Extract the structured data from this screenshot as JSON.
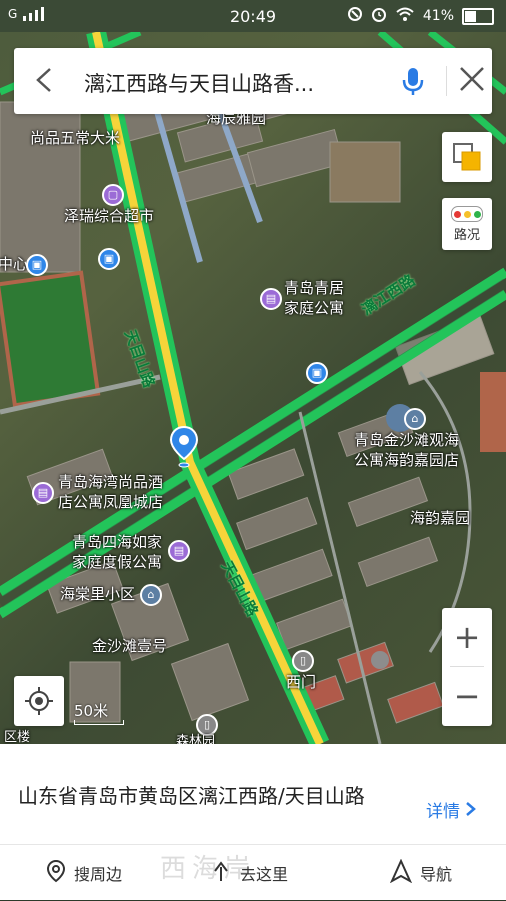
{
  "status_bar": {
    "carrier": "G",
    "time": "20:49",
    "battery": "41%"
  },
  "search": {
    "query": "漓江西路与天目山路香...",
    "back_icon": "chevron-left-icon",
    "mic_icon": "microphone-icon",
    "close_icon": "close-icon"
  },
  "map": {
    "pois": [
      {
        "name": "尚品五常大米"
      },
      {
        "name": "泽瑞综合超市"
      },
      {
        "name": "海辰雅园"
      },
      {
        "name": "中心"
      },
      {
        "name": "青岛青居\n家庭公寓"
      },
      {
        "name": "青岛金沙滩观海\n公寓海韵嘉园店"
      },
      {
        "name": "海韵嘉园"
      },
      {
        "name": "青岛海湾尚品酒\n店公寓凤凰城店"
      },
      {
        "name": "青岛四海如家\n家庭度假公寓"
      },
      {
        "name": "海棠里小区"
      },
      {
        "name": "金沙滩壹号"
      },
      {
        "name": "西门"
      },
      {
        "name": "区楼"
      },
      {
        "name": "森林园"
      }
    ],
    "roads": [
      {
        "name": "漓江西路"
      },
      {
        "name": "天目山路"
      },
      {
        "name": "天目山路"
      }
    ],
    "scale": "50米"
  },
  "controls": {
    "layer_icon": "layers-icon",
    "traffic_label": "路况",
    "zoom_in": "+",
    "zoom_out": "−",
    "locate_icon": "locate-icon"
  },
  "panel": {
    "address": "山东省青岛市黄岛区漓江西路/天目山路",
    "detail_label": "详情",
    "actions": [
      {
        "label": "搜周边",
        "icon": "location-pin-icon"
      },
      {
        "label": "去这里",
        "icon": "route-icon"
      },
      {
        "label": "导航",
        "icon": "navigation-arrow-icon"
      }
    ],
    "watermark": "西海岸"
  },
  "colors": {
    "accent": "#2a7be4",
    "road_green": "#23c45a",
    "road_yellow": "#f6d43a",
    "pin_blue": "#2f86e8",
    "poi_purple": "#9b6bd6"
  }
}
